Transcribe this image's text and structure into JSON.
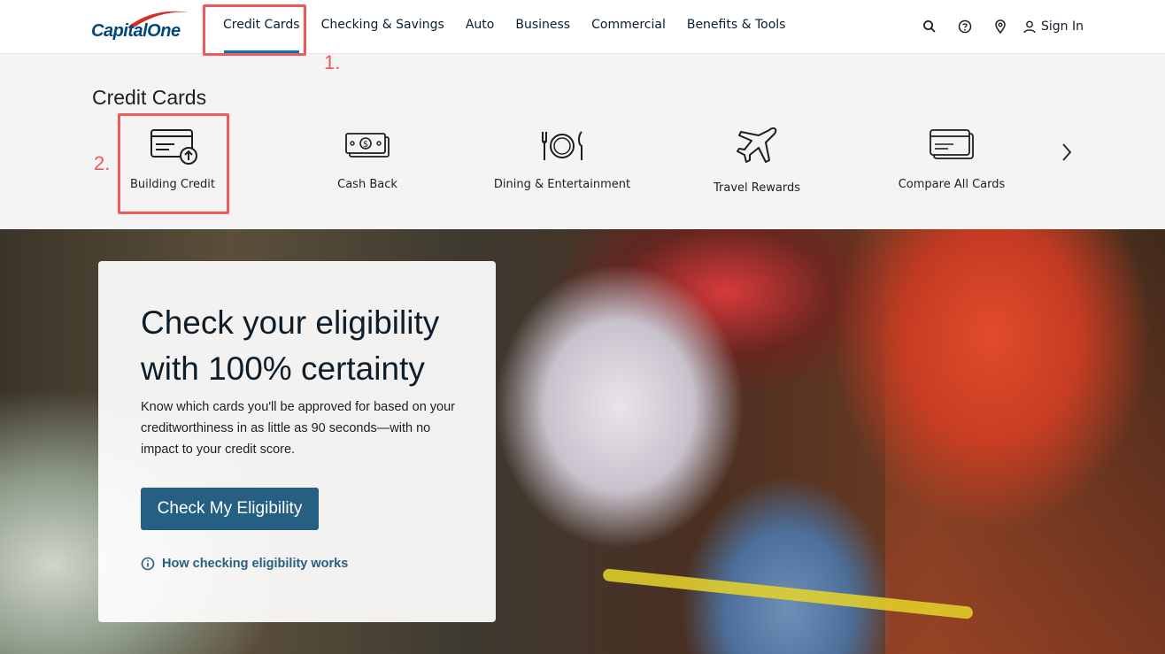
{
  "brand": {
    "logo_text": "CapitalOne"
  },
  "nav": {
    "items": [
      {
        "label": "Credit Cards"
      },
      {
        "label": "Checking & Savings"
      },
      {
        "label": "Auto"
      },
      {
        "label": "Business"
      },
      {
        "label": "Commercial"
      },
      {
        "label": "Benefits & Tools"
      }
    ],
    "active": "Credit Cards",
    "sign_in": "Sign In",
    "icons": [
      "search-icon",
      "help-icon",
      "location-icon",
      "user-icon"
    ]
  },
  "annotations": {
    "step1": "1.",
    "step2": "2.",
    "color": "#f0595c"
  },
  "subnav": {
    "title": "Credit Cards",
    "categories": [
      {
        "label": "Building Credit",
        "icon": "card-upgrade-icon"
      },
      {
        "label": "Cash Back",
        "icon": "cash-icon"
      },
      {
        "label": "Dining & Entertainment",
        "icon": "dining-icon"
      },
      {
        "label": "Travel Rewards",
        "icon": "airplane-icon"
      },
      {
        "label": "Compare All Cards",
        "icon": "cards-stack-icon"
      }
    ],
    "next_icon": "chevron-right-icon"
  },
  "hero": {
    "headline": "Check your eligibility with 100% certainty",
    "body": "Know which cards you'll be approved for based on your creditworthiness in as little as 90 seconds—with no impact to your credit score.",
    "cta": "Check My Eligibility",
    "info_link": "How checking eligibility works"
  },
  "colors": {
    "brand_blue": "#004879",
    "cta_blue": "#255f82",
    "active_underline": "#0276b1",
    "logo_red": "#d03027"
  }
}
